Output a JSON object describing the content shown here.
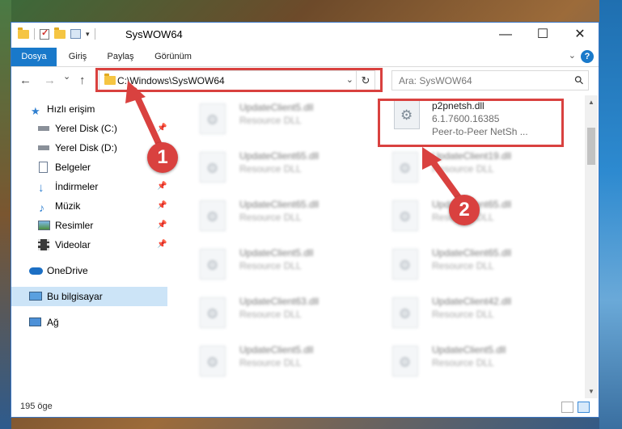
{
  "window": {
    "title": "SysWOW64"
  },
  "ribbon": {
    "tabs": [
      "Dosya",
      "Giriş",
      "Paylaş",
      "Görünüm"
    ],
    "active_tab": "Dosya",
    "help": "?"
  },
  "nav": {
    "back": "←",
    "forward": "→",
    "recent": "⌄",
    "up": "↑"
  },
  "address": {
    "path": "C:\\Windows\\SysWOW64",
    "dropdown": "⌄",
    "refresh": "↻"
  },
  "search": {
    "placeholder": "Ara: SysWOW64"
  },
  "sidebar": {
    "items": [
      {
        "label": "Hızlı erişim",
        "icon": "star-icon"
      },
      {
        "label": "Yerel Disk (C:)",
        "icon": "drive-icon",
        "pinned": true
      },
      {
        "label": "Yerel Disk (D:)",
        "icon": "drive-icon"
      },
      {
        "label": "Belgeler",
        "icon": "documents-icon"
      },
      {
        "label": "İndirmeler",
        "icon": "download-icon",
        "pinned": true
      },
      {
        "label": "Müzik",
        "icon": "music-icon",
        "pinned": true
      },
      {
        "label": "Resimler",
        "icon": "pictures-icon",
        "pinned": true
      },
      {
        "label": "Videolar",
        "icon": "video-icon",
        "pinned": true
      },
      {
        "label": "OneDrive",
        "icon": "cloud-icon"
      },
      {
        "label": "Bu bilgisayar",
        "icon": "computer-icon",
        "selected": true
      },
      {
        "label": "Ağ",
        "icon": "network-icon"
      }
    ]
  },
  "files_left": [
    {
      "name": "UpdateClient5.dll",
      "type": "Resource DLL"
    },
    {
      "name": "UpdateClient65.dll",
      "type": "Resource DLL"
    },
    {
      "name": "UpdateClient65.dll",
      "type": "Resource DLL"
    },
    {
      "name": "UpdateClient5.dll",
      "type": "Resource DLL"
    },
    {
      "name": "UpdateClient63.dll",
      "type": "Resource DLL"
    },
    {
      "name": "UpdateClient5.dll",
      "type": "Resource DLL"
    }
  ],
  "files_right": [
    {
      "name": "p2pnetsh.dll",
      "version": "6.1.7600.16385",
      "desc": "Peer-to-Peer NetSh ..."
    },
    {
      "name": "UpdateClient19.dll",
      "type": "Resource DLL"
    },
    {
      "name": "UpdateClient65.dll",
      "type": "Resource DLL"
    },
    {
      "name": "UpdateClient65.dll",
      "type": "Resource DLL"
    },
    {
      "name": "UpdateClient42.dll",
      "type": "Resource DLL"
    },
    {
      "name": "UpdateClient5.dll",
      "type": "Resource DLL"
    }
  ],
  "status": {
    "count": "195 öge"
  },
  "callouts": [
    "1",
    "2"
  ],
  "colors": {
    "accent": "#1979ca",
    "annotation": "#d9413f",
    "selection": "#cce4f7"
  }
}
